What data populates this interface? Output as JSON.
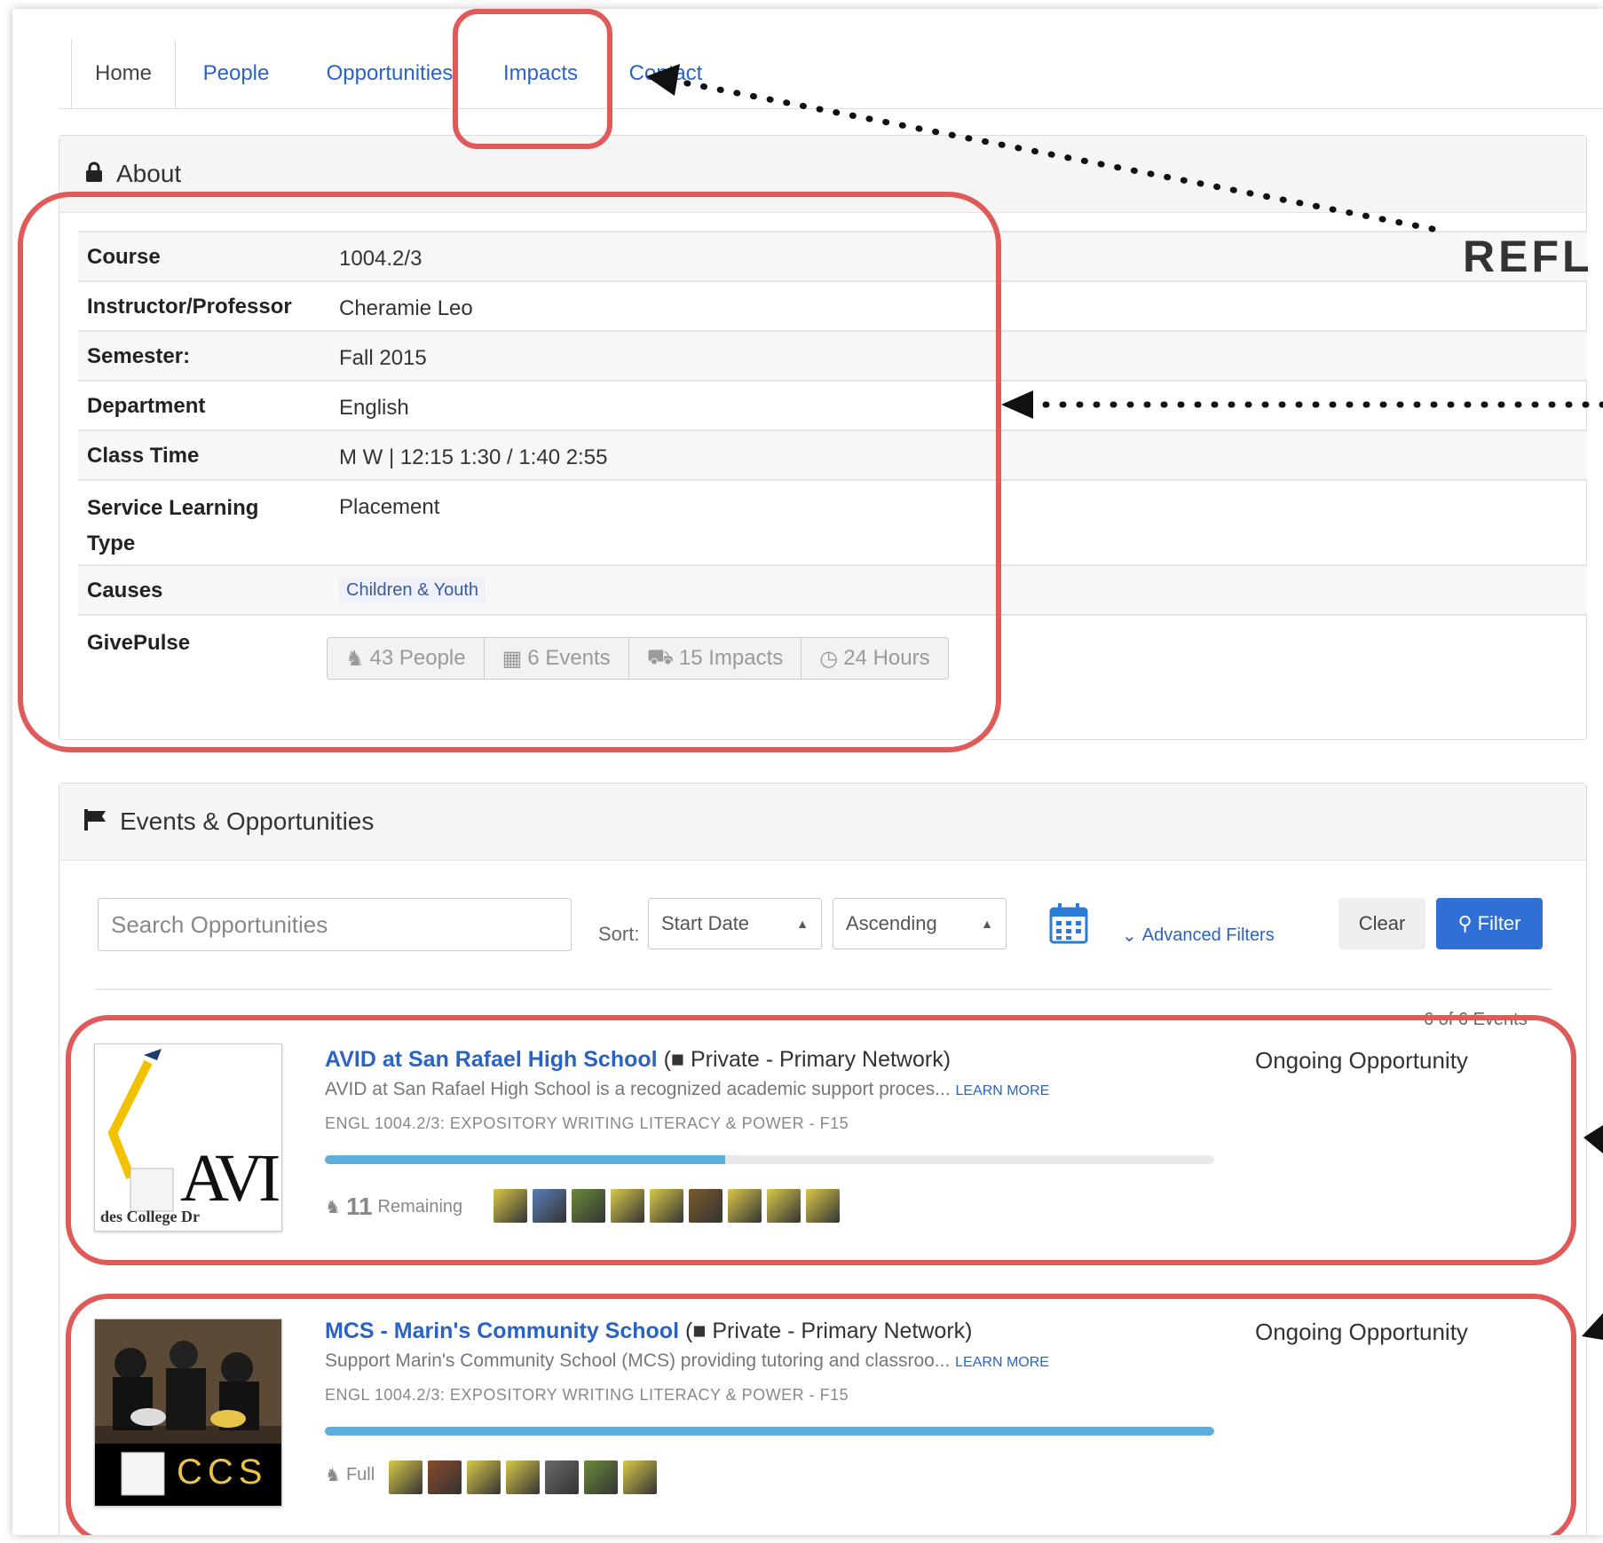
{
  "nav": {
    "tabs": [
      {
        "label": "Home",
        "active": true
      },
      {
        "label": "People"
      },
      {
        "label": "Opportunities"
      },
      {
        "label": "Impacts"
      },
      {
        "label": "Contact"
      }
    ]
  },
  "about": {
    "title": "About",
    "rows": [
      {
        "label": "Course",
        "value": "1004.2/3"
      },
      {
        "label": "Instructor/Professor",
        "value": "Cheramie Leo"
      },
      {
        "label": "Semester:",
        "value": "Fall 2015"
      },
      {
        "label": "Department",
        "value": "English"
      },
      {
        "label": "Class Time",
        "value": "M W | 12:15 1:30 / 1:40 2:55"
      },
      {
        "label_1": "Service Learning",
        "label_2": "Type",
        "value": "Placement"
      },
      {
        "label": "Causes",
        "value": "Children & Youth"
      },
      {
        "label": "GivePulse"
      }
    ],
    "givepulse": {
      "people": "43 People",
      "events": "6 Events",
      "impacts": "15 Impacts",
      "hours": "24 Hours"
    }
  },
  "events": {
    "title": "Events & Opportunities",
    "search_placeholder": "Search Opportunities",
    "sort_label": "Sort:",
    "sort_by": "Start Date",
    "sort_order": "Ascending",
    "advanced_filters": "Advanced Filters",
    "clear": "Clear",
    "filter": "Filter",
    "count": "6 of 6 Events",
    "items": [
      {
        "title": "AVID at San Rafael High School",
        "privacy": "Private - Primary Network)",
        "description": "AVID at San Rafael High School is a recognized academic support proces...",
        "learn_more": "LEARN MORE",
        "course": "ENGL 1004.2/3: EXPOSITORY WRITING LITERACY & POWER - F15",
        "status": "Ongoing Opportunity",
        "remaining_count": "11",
        "remaining_label": "Remaining",
        "progress": 0.45,
        "thumb_text": "AVI",
        "thumb_caption": "des College Dr"
      },
      {
        "title": "MCS - Marin's Community School",
        "privacy": "Private - Primary Network)",
        "description": "Support Marin's Community School (MCS) providing tutoring and classroo...",
        "learn_more": "LEARN MORE",
        "course": "ENGL 1004.2/3: EXPOSITORY WRITING LITERACY & POWER - F15",
        "status": "Ongoing Opportunity",
        "remaining_label": "Full",
        "progress": 1.0,
        "thumb_text": "CCS"
      }
    ]
  },
  "annotation": {
    "label": "REFL"
  },
  "colors": {
    "link": "#2a63c4",
    "highlight": "#e05a5a",
    "primary_button": "#2f6fd6",
    "progress": "#5bb0de"
  }
}
